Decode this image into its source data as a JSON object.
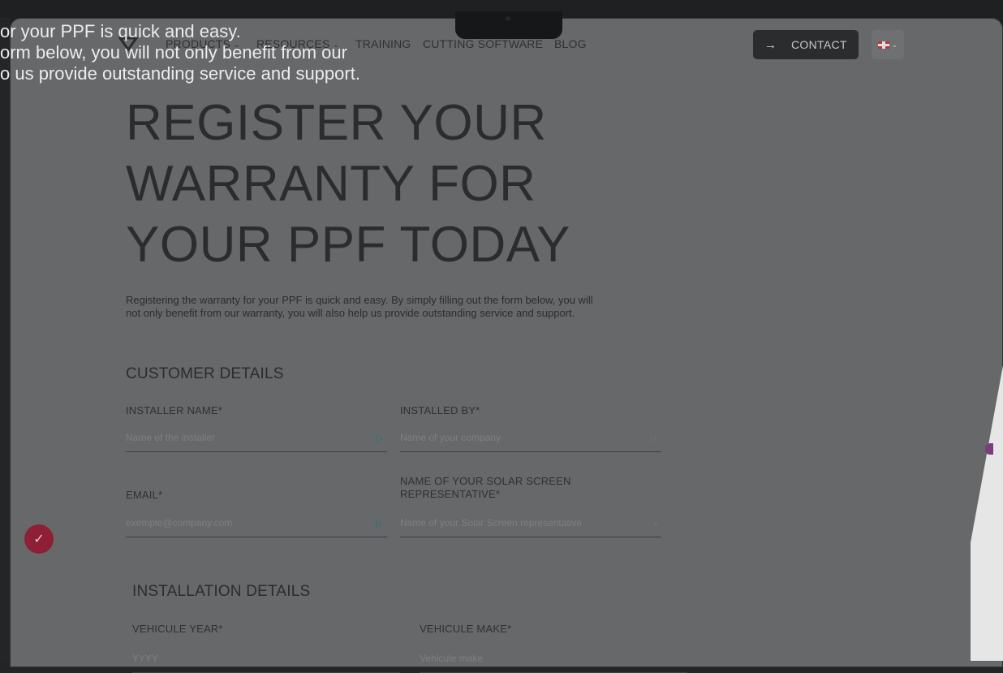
{
  "nav": {
    "items": [
      {
        "label": "PRODUCTS",
        "dropdown": true
      },
      {
        "label": "RESOURCES",
        "dropdown": true
      },
      {
        "label": "TRAINING",
        "dropdown": false
      },
      {
        "label": "CUTTING SOFTWARE",
        "dropdown": false
      },
      {
        "label": "BLOG",
        "dropdown": false
      }
    ],
    "contact_label": "CONTACT",
    "contact_arrow": "→",
    "language_icon": "uk-flag-icon"
  },
  "overlay_text": [
    "or your PPF is quick and easy.",
    "orm below, you will not only benefit from our",
    "o us provide outstanding service and support."
  ],
  "hero": {
    "title_lines": [
      "REGISTER YOUR",
      "WARRANTY FOR",
      "YOUR PPF TODAY"
    ],
    "intro_line1": "Registering the warranty for your PPF is quick and easy. By simply filling out the form below, you will",
    "intro_line2": "not only benefit from our warranty, you will also help us provide outstanding service and support."
  },
  "customer_details": {
    "heading": "CUSTOMER DETAILS",
    "installer_name": {
      "label": "INSTALLER NAME*",
      "placeholder": "Name of the installer"
    },
    "installed_by": {
      "label": "INSTALLED BY*",
      "placeholder": "Name of your company"
    },
    "email": {
      "label": "EMAIL*",
      "placeholder": "exemple@company.com"
    },
    "representative": {
      "label_line1": "NAME OF YOUR SOLAR SCREEN",
      "label_line2": "REPRESENTATIVE*",
      "placeholder": "Name of your Solar Screen representative"
    }
  },
  "installation_details": {
    "heading": "INSTALLATION DETAILS",
    "vehicle_year": {
      "label": "VEHICULE YEAR*",
      "placeholder": "YYYY"
    },
    "vehicle_make": {
      "label": "VEHICULE MAKE*",
      "placeholder": "Vehicule make"
    }
  },
  "colors": {
    "accent_badge": "#8d2035",
    "contact_bg": "#2b2c2e",
    "page_bg": "#676869"
  }
}
